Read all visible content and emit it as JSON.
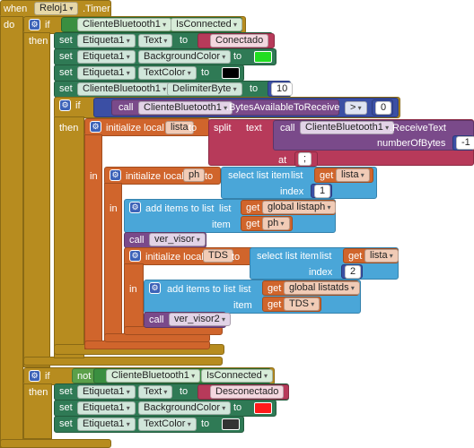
{
  "event": {
    "when": "when",
    "component": "Reloj1",
    "event_name": ".Timer",
    "do": "do"
  },
  "block1": {
    "if": "if",
    "then": "then",
    "cond_component": "ClienteBluetooth1",
    "cond_prop": "IsConnected",
    "set": "set",
    "to": "to",
    "s1_comp": "Etiqueta1",
    "s1_prop": "Text",
    "s1_val": "Conectado",
    "s2_comp": "Etiqueta1",
    "s2_prop": "BackgroundColor",
    "s2_color": "#22dd22",
    "s3_comp": "Etiqueta1",
    "s3_prop": "TextColor",
    "s3_color": "#000000",
    "s4_comp": "ClienteBluetooth1",
    "s4_prop": "DelimiterByte",
    "s4_val": "10"
  },
  "block2": {
    "if": "if",
    "then": "then",
    "call": "call",
    "comp": "ClienteBluetooth1",
    "method": ".BytesAvailableToReceive",
    "op": ">",
    "val": "0"
  },
  "local1": {
    "init": "initialize local",
    "name": "lista",
    "to": "to",
    "split": "split",
    "text": "text",
    "call": "call",
    "comp": "ClienteBluetooth1",
    "method": ".ReceiveText",
    "nbytes": "numberOfBytes",
    "nbytes_val": "-1",
    "at": "at",
    "at_val": ";"
  },
  "local2": {
    "in": "in",
    "init": "initialize local",
    "name": "ph",
    "to": "to",
    "select": "select list item",
    "list": "list",
    "get": "get",
    "get_var": "lista",
    "index": "index",
    "index_val": "1"
  },
  "add1": {
    "in": "in",
    "add": "add items to list",
    "list": "list",
    "get": "get",
    "list_var": "global listaph",
    "item": "item",
    "item_var": "ph"
  },
  "call1": {
    "call": "call",
    "proc": "ver_visor"
  },
  "local3": {
    "init": "initialize local",
    "name": "TDS",
    "to": "to",
    "select": "select list item",
    "list": "list",
    "get": "get",
    "get_var": "lista",
    "index": "index",
    "index_val": "2"
  },
  "add2": {
    "in": "in",
    "add": "add items to list",
    "list": "list",
    "get": "get",
    "list_var": "global listatds",
    "item": "item",
    "item_var": "TDS"
  },
  "call2": {
    "call": "call",
    "proc": "ver_visor2"
  },
  "block3": {
    "if": "if",
    "then": "then",
    "not": "not",
    "cond_component": "ClienteBluetooth1",
    "cond_prop": "IsConnected",
    "set": "set",
    "to": "to",
    "s1_comp": "Etiqueta1",
    "s1_prop": "Text",
    "s1_val": "Desconectado",
    "s2_comp": "Etiqueta1",
    "s2_prop": "BackgroundColor",
    "s2_color": "#ff1a1a",
    "s3_comp": "Etiqueta1",
    "s3_prop": "TextColor",
    "s3_color": "#333333"
  }
}
